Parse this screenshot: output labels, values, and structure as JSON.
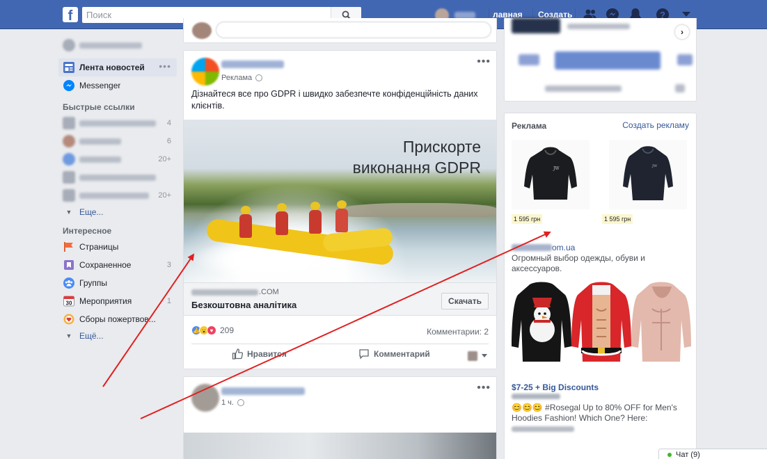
{
  "header": {
    "search_placeholder": "Поиск",
    "home_label": "лавная",
    "create_label": "Создать",
    "icons": [
      "friends-icon",
      "messenger-icon",
      "notifications-icon",
      "help-icon",
      "account-menu-icon"
    ]
  },
  "leftnav": {
    "news_feed": "Лента новостей",
    "messenger": "Messenger",
    "shortcuts_heading": "Быстрые ссылки",
    "shortcut_counts": [
      "4",
      "6",
      "20+",
      "",
      "20+"
    ],
    "more1": "Еще...",
    "explore_heading": "Интересное",
    "explore_items": [
      {
        "label": "Страницы",
        "count": ""
      },
      {
        "label": "Сохраненное",
        "count": "3"
      },
      {
        "label": "Группы",
        "count": ""
      },
      {
        "label": "Мероприятия",
        "count": "1"
      },
      {
        "label": "Сборы пожертвов...",
        "count": ""
      }
    ],
    "calendar_day": "30",
    "more2": "Ещё..."
  },
  "post1": {
    "sponsored": "Реклама",
    "text": "Дізнайтеся все про GDPR і швидко забезпечте конфіденційність даних клієнтів.",
    "image_title_1": "Прискорте",
    "image_title_2": "виконання GDPR",
    "link_domain_suffix": ".COM",
    "link_title": "Безкоштовна аналітика",
    "cta": "Скачать",
    "reaction_count": "209",
    "comment_count": "Комментарии: 2",
    "like": "Нравится",
    "comment": "Комментарий"
  },
  "post2": {
    "time": "1 ч."
  },
  "ads": {
    "heading": "Реклама",
    "create": "Создать рекламу",
    "price1": "1 595 грн",
    "price2": "1 595 грн",
    "domain_suffix": "om.ua",
    "description": "Огромный выбор одежды, обуви и аксессуаров.",
    "ad2_title": "$7-25 + Big Discounts",
    "ad2_description": "😊😊😊 #Rosegal Up to 80% OFF for Men's Hoodies Fashion! Which One? Here:"
  },
  "chat": {
    "label": "Чат (9)"
  },
  "colors": {
    "facebook_blue": "#4267b2",
    "link_blue": "#365899",
    "annotation_red": "#e02020"
  }
}
